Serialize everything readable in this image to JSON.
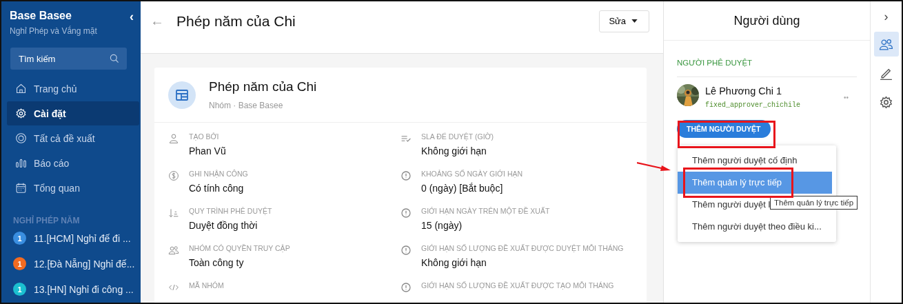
{
  "sidebar": {
    "title": "Base Basee",
    "subtitle": "Nghỉ Phép và Vắng mặt",
    "collapse_glyph": "‹",
    "search": {
      "placeholder": "Tìm kiếm"
    },
    "items": [
      {
        "label": "Trang chủ",
        "kind": "home",
        "selected": false
      },
      {
        "label": "Cài đặt",
        "kind": "gear",
        "selected": true
      },
      {
        "label": "Tất cả đề xuất",
        "kind": "ring",
        "selected": false
      },
      {
        "label": "Báo cáo",
        "kind": "bars",
        "selected": false
      },
      {
        "label": "Tổng quan",
        "kind": "calendar",
        "selected": false
      }
    ],
    "section": "NGHỈ PHÉP NĂM",
    "groups": [
      {
        "count": "1",
        "color": "#3a8ee0",
        "label": "11.[HCM] Nghỉ đế đi ..."
      },
      {
        "count": "1",
        "color": "#f26b21",
        "label": "12.[Đà Nẵng] Nghỉ đế..."
      },
      {
        "count": "1",
        "color": "#1bbfd0",
        "label": "13.[HN] Nghỉ đi công ..."
      }
    ]
  },
  "header": {
    "back_glyph": "←",
    "title": "Phép năm của Chi",
    "edit_button": "Sửa"
  },
  "card": {
    "title": "Phép năm của Chi",
    "subtitle": "Nhóm · Base Basee",
    "fields": [
      {
        "kind": "person",
        "label": "TẠO BỞI",
        "value": "Phan Vũ"
      },
      {
        "kind": "checklist",
        "label": "SLA ĐỂ DUYỆT (GIỜ)",
        "value": "Không giới hạn"
      },
      {
        "kind": "dollar",
        "label": "GHI NHẬN CÔNG",
        "value": "Có tính công"
      },
      {
        "kind": "alert",
        "label": "KHOẢNG SỐ NGÀY GIỚI HẠN",
        "value": "0 (ngày) [Bắt buộc]"
      },
      {
        "kind": "sort",
        "label": "QUY TRÌNH PHÊ DUYỆT",
        "value": "Duyệt đồng thời"
      },
      {
        "kind": "alert",
        "label": "GIỚI HẠN NGÀY TRÊN MỘT ĐỀ XUẤT",
        "value": "15 (ngày)"
      },
      {
        "kind": "people",
        "label": "NHÓM CÓ QUYỀN TRUY CẬP",
        "value": "Toàn công ty"
      },
      {
        "kind": "alert",
        "label": "GIỚI HẠN SỐ LƯỢNG ĐỀ XUẤT ĐƯỢC DUYỆT MỖI THÁNG",
        "value": "Không giới hạn"
      },
      {
        "kind": "code",
        "label": "MÃ NHÓM"
      },
      {
        "kind": "alert",
        "label": "GIỚI HẠN SỐ LƯỢNG ĐỀ XUẤT ĐƯỢC TẠO MỖI THÁNG"
      }
    ]
  },
  "panel": {
    "title": "Người dùng",
    "section": "NGƯỜI PHÊ DUYỆT",
    "approver": {
      "name": "Lê Phương Chi 1",
      "id": "fixed_approver_chichile",
      "more_glyph": "••"
    },
    "add_button": "THÊM NGƯỜI DUYỆT",
    "menu": [
      {
        "label": "Thêm người duyệt cố định",
        "selected": false
      },
      {
        "label": "Thêm quản lý trực tiếp",
        "selected": true
      },
      {
        "label": "Thêm người duyệt l",
        "selected": false
      },
      {
        "label": "Thêm người duyệt theo điều ki...",
        "selected": false
      }
    ],
    "tooltip": "Thêm quản lý trực tiếp"
  },
  "rail": {
    "expand_glyph": "›",
    "tools": [
      {
        "kind": "people",
        "selected": true
      },
      {
        "kind": "pencil",
        "selected": false
      },
      {
        "kind": "gear",
        "selected": false
      }
    ]
  }
}
